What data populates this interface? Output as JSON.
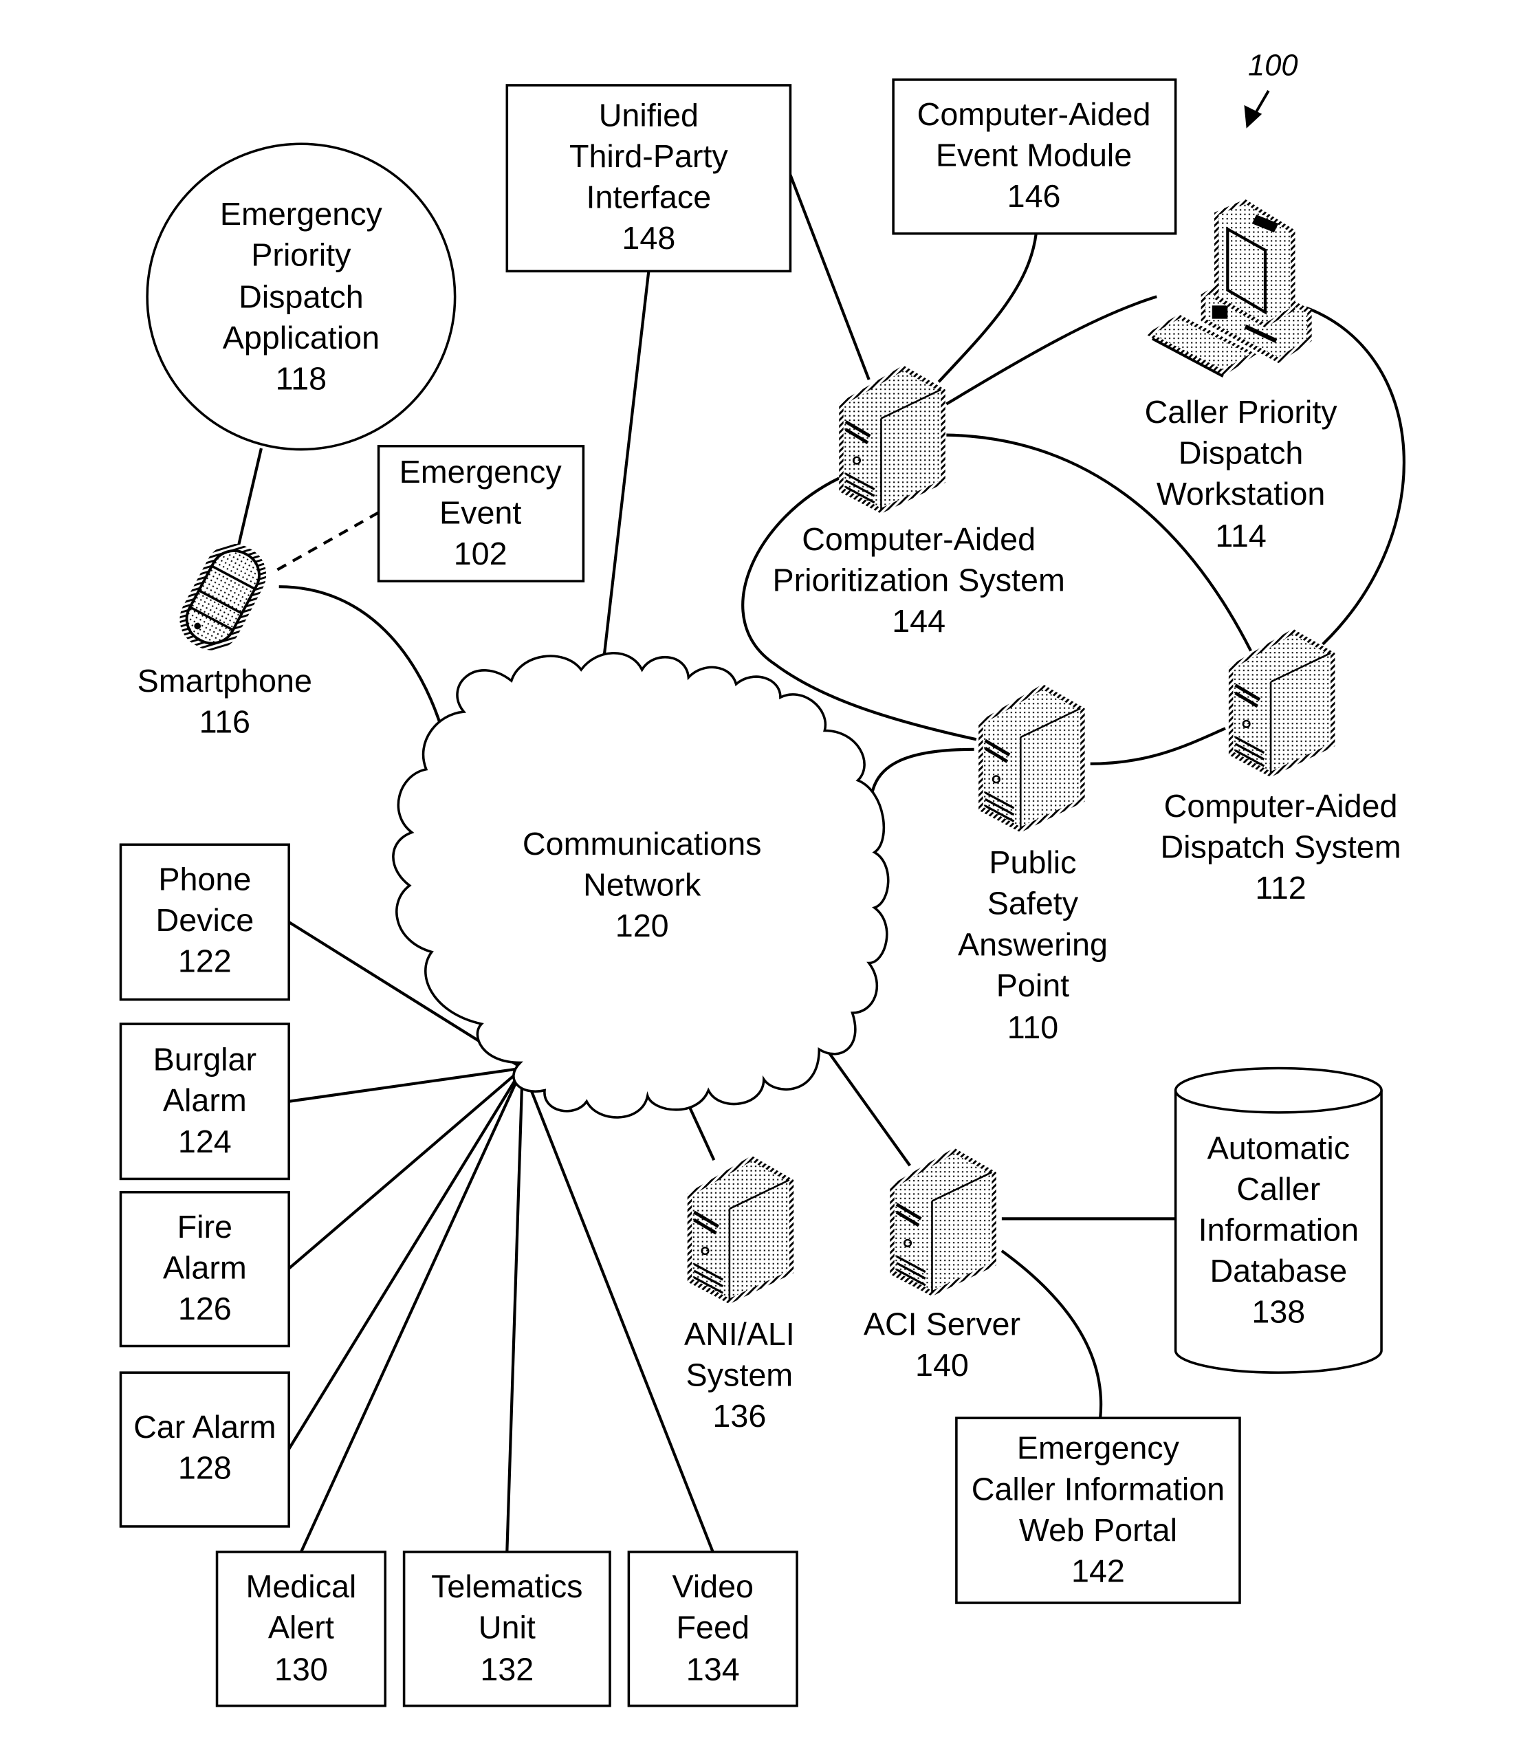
{
  "figure": {
    "reference": "100",
    "colors": {
      "ink": "#000000",
      "background": "#ffffff",
      "halftone": "#8a8a8a"
    }
  },
  "nodes": {
    "epda": {
      "lines": [
        "Emergency",
        "Priority",
        "Dispatch",
        "Application"
      ],
      "number": "118",
      "shape": "circle"
    },
    "utpi": {
      "lines": [
        "Unified",
        "Third-Party",
        "Interface"
      ],
      "number": "148",
      "shape": "box"
    },
    "caem": {
      "lines": [
        "Computer-Aided",
        "Event Module"
      ],
      "number": "146",
      "shape": "box"
    },
    "event": {
      "lines": [
        "Emergency",
        "Event"
      ],
      "number": "102",
      "shape": "box"
    },
    "smartphone": {
      "lines": [
        "Smartphone"
      ],
      "number": "116",
      "icon": "smartphone-icon"
    },
    "caps": {
      "lines": [
        "Computer-Aided",
        "Prioritization System"
      ],
      "number": "144",
      "icon": "server-icon"
    },
    "cpdw": {
      "lines": [
        "Caller Priority",
        "Dispatch",
        "Workstation"
      ],
      "number": "114",
      "icon": "workstation-icon"
    },
    "psap": {
      "lines": [
        "Public",
        "Safety",
        "Answering",
        "Point"
      ],
      "number": "110",
      "icon": "server-icon"
    },
    "cad": {
      "lines": [
        "Computer-Aided",
        "Dispatch System"
      ],
      "number": "112",
      "icon": "server-icon"
    },
    "network": {
      "lines": [
        "Communications",
        "Network"
      ],
      "number": "120",
      "shape": "cloud"
    },
    "phone": {
      "lines": [
        "Phone",
        "Device"
      ],
      "number": "122",
      "shape": "box"
    },
    "burglar": {
      "lines": [
        "Burglar",
        "Alarm"
      ],
      "number": "124",
      "shape": "box"
    },
    "fire": {
      "lines": [
        "Fire",
        "Alarm"
      ],
      "number": "126",
      "shape": "box"
    },
    "car": {
      "lines": [
        "Car Alarm"
      ],
      "number": "128",
      "shape": "box"
    },
    "medical": {
      "lines": [
        "Medical",
        "Alert"
      ],
      "number": "130",
      "shape": "box"
    },
    "telematics": {
      "lines": [
        "Telematics",
        "Unit"
      ],
      "number": "132",
      "shape": "box"
    },
    "video": {
      "lines": [
        "Video",
        "Feed"
      ],
      "number": "134",
      "shape": "box"
    },
    "anili": {
      "lines": [
        "ANI/ALI",
        "System"
      ],
      "number": "136",
      "icon": "server-icon"
    },
    "aci": {
      "lines": [
        "ACI Server"
      ],
      "number": "140",
      "icon": "server-icon"
    },
    "acidb": {
      "lines": [
        "Automatic",
        "Caller",
        "Information",
        "Database"
      ],
      "number": "138",
      "shape": "cylinder"
    },
    "ecip": {
      "lines": [
        "Emergency",
        "Caller Information",
        "Web Portal"
      ],
      "number": "142",
      "shape": "box"
    }
  },
  "edges": [
    {
      "from": "118",
      "to": "116",
      "style": "solid"
    },
    {
      "from": "102",
      "to": "116",
      "style": "dashed"
    },
    {
      "from": "116",
      "to": "120",
      "style": "solid"
    },
    {
      "from": "148",
      "to": "120",
      "style": "solid"
    },
    {
      "from": "148",
      "to": "144",
      "style": "solid"
    },
    {
      "from": "146",
      "to": "144",
      "style": "solid"
    },
    {
      "from": "144",
      "to": "114",
      "style": "solid"
    },
    {
      "from": "144",
      "to": "112",
      "style": "solid"
    },
    {
      "from": "144",
      "to": "110",
      "style": "solid"
    },
    {
      "from": "114",
      "to": "112",
      "style": "solid"
    },
    {
      "from": "110",
      "to": "112",
      "style": "solid"
    },
    {
      "from": "120",
      "to": "110",
      "style": "solid"
    },
    {
      "from": "122",
      "to": "120",
      "style": "solid"
    },
    {
      "from": "124",
      "to": "120",
      "style": "solid"
    },
    {
      "from": "126",
      "to": "120",
      "style": "solid"
    },
    {
      "from": "128",
      "to": "120",
      "style": "solid"
    },
    {
      "from": "130",
      "to": "120",
      "style": "solid"
    },
    {
      "from": "132",
      "to": "120",
      "style": "solid"
    },
    {
      "from": "134",
      "to": "120",
      "style": "solid"
    },
    {
      "from": "120",
      "to": "136",
      "style": "solid"
    },
    {
      "from": "120",
      "to": "140",
      "style": "solid"
    },
    {
      "from": "140",
      "to": "138",
      "style": "solid"
    },
    {
      "from": "140",
      "to": "142",
      "style": "solid"
    }
  ]
}
